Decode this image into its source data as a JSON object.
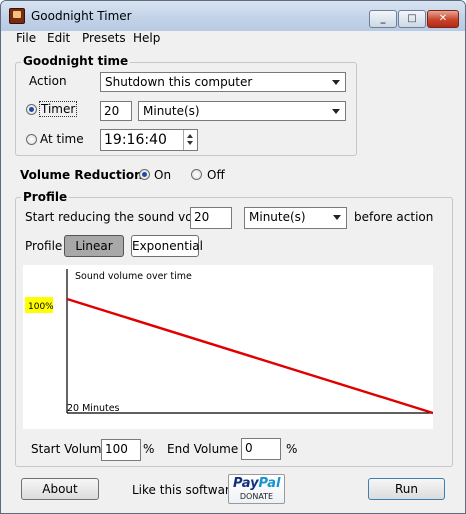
{
  "window": {
    "title": "Goodnight Timer"
  },
  "menu": [
    "File",
    "Edit",
    "Presets",
    "Help"
  ],
  "goodnight": {
    "group_title": "Goodnight time",
    "action_label": "Action",
    "action_value": "Shutdown this computer",
    "timer_label": "Timer",
    "timer_value": "20",
    "timer_unit": "Minute(s)",
    "at_time_label": "At time",
    "at_time_value": "19:16:40",
    "mode_selected": "Timer"
  },
  "volume_reduction": {
    "label": "Volume Reduction",
    "on_label": "On",
    "off_label": "Off",
    "selected": "On"
  },
  "profile": {
    "group_title": "Profile",
    "start_reducing_label": "Start reducing the sound volur",
    "start_reducing_value": "20",
    "start_reducing_unit": "Minute(s)",
    "before_action_label": "before action",
    "profile_label": "Profile",
    "linear_label": "Linear",
    "exponential_label": "Exponential",
    "selected": "Linear"
  },
  "chart_data": {
    "type": "line",
    "title": "Sound volume over time",
    "start_label": "100%",
    "end_label": "20 Minutes",
    "x": [
      0,
      20
    ],
    "values": [
      100,
      0
    ],
    "xlim": [
      0,
      20
    ],
    "ylim": [
      0,
      100
    ],
    "line_color": "#e00000",
    "highlight_color": "#ffff00"
  },
  "volumes": {
    "start_label": "Start Volume",
    "start_value": "100",
    "end_label": "End Volume",
    "end_value": "0",
    "percent": "%"
  },
  "footer": {
    "about_label": "About",
    "like_label": "Like this software",
    "paypal_text_1": "Pay",
    "paypal_text_2": "Pal",
    "donate_label": "DONATE",
    "run_label": "Run"
  }
}
